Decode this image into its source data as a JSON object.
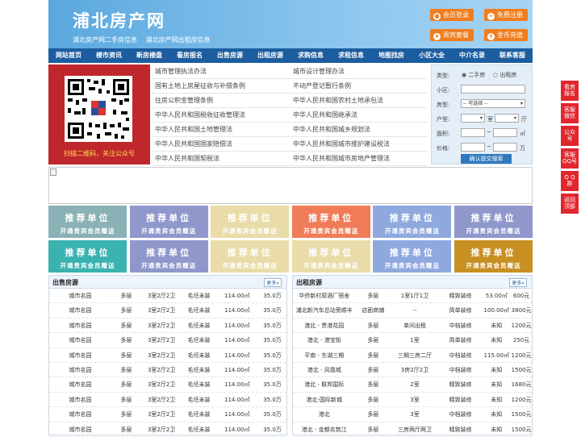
{
  "header": {
    "logo": "浦北房产网",
    "subtitle_1": "浦北房产网二手房信息",
    "subtitle_2": "浦北房产网出租房信息",
    "buttons": [
      "会员登录",
      "免费注册",
      "贵宾套餐",
      "金币充值"
    ]
  },
  "nav": [
    "网站首页",
    "楼市资讯",
    "新房楼盘",
    "看房报名",
    "出售房源",
    "出租房源",
    "求购信息",
    "求租信息",
    "地图找房",
    "小区大全",
    "中介名录",
    "联系客服"
  ],
  "qr": {
    "caption": "扫描二维码，关注公众号"
  },
  "laws": [
    [
      "城市管理执法办法",
      "城市设计管理办法"
    ],
    [
      "国有土地上房屋征收与补偿条例",
      "不动产登记暂行条例"
    ],
    [
      "住房公积金管理条例",
      "中华人民共和国农村土地承包法"
    ],
    [
      "中华人民共和国税收征收管理法",
      "中华人民共和国继承法"
    ],
    [
      "中华人民共和国土地管理法",
      "中华人民共和国城乡规划法"
    ],
    [
      "中华人民共和国国家赔偿法",
      "中华人民共和国城市维护建设税法"
    ],
    [
      "中华人民共和国契税法",
      "中华人民共和国城市房地产管理法"
    ]
  ],
  "search": {
    "type_label": "类型:",
    "type_options": [
      "二手房",
      "出租房"
    ],
    "community_label": "小区:",
    "housetype_label": "房型:",
    "housetype_value": "-- 可选择 --",
    "layout_label": "户型:",
    "room_unit": "室",
    "hall_unit": "厅",
    "area_label": "面积:",
    "area_unit": "㎡",
    "price_label": "价格:",
    "price_unit": "万",
    "submit": "确认提交搜索"
  },
  "ads": {
    "title": "推荐单位",
    "sub": "开通贵宾会员赠送"
  },
  "colors": {
    "ad_row1": [
      "#8ab1b5",
      "#8f97cb",
      "#e9dca9",
      "#ef7c57",
      "#8fa9df",
      "#8f97cb"
    ],
    "ad_row2": [
      "#3ab2b0",
      "#8f97cb",
      "#e9dca9",
      "#e9dca9",
      "#8fa9df",
      "#c88f22"
    ]
  },
  "sale": {
    "title": "出售房源",
    "more": "更多»",
    "rows": [
      [
        "城市名园",
        "多层",
        "3室2厅2卫",
        "毛坯未装",
        "114.00㎡",
        "35.0万"
      ],
      [
        "城市名园",
        "多层",
        "3室2厅2卫",
        "毛坯未装",
        "114.00㎡",
        "35.0万"
      ],
      [
        "城市名园",
        "多层",
        "3室2厅2卫",
        "毛坯未装",
        "114.00㎡",
        "35.0万"
      ],
      [
        "城市名园",
        "多层",
        "3室2厅2卫",
        "毛坯未装",
        "114.00㎡",
        "35.0万"
      ],
      [
        "城市名园",
        "多层",
        "3室2厅2卫",
        "毛坯未装",
        "114.00㎡",
        "35.0万"
      ],
      [
        "城市名园",
        "多层",
        "3室2厅2卫",
        "毛坯未装",
        "114.00㎡",
        "35.0万"
      ],
      [
        "城市名园",
        "多层",
        "3室2厅2卫",
        "毛坯未装",
        "114.00㎡",
        "35.0万"
      ],
      [
        "城市名园",
        "多层",
        "3室2厅2卫",
        "毛坯未装",
        "114.00㎡",
        "35.0万"
      ],
      [
        "城市名园",
        "多层",
        "3室2厅2卫",
        "毛坯未装",
        "114.00㎡",
        "35.0万"
      ],
      [
        "城市名园",
        "多层",
        "3室2厅2卫",
        "毛坯未装",
        "114.00㎡",
        "35.0万"
      ]
    ]
  },
  "rent": {
    "title": "出租房源",
    "more": "更多»",
    "rows": [
      [
        "华侨新村原酒厂宿舍",
        "多层",
        "1室1厅1卫",
        "精致装修",
        "53.00㎡",
        "600元"
      ],
      [
        "浦北新汽车总站旁顺丰",
        "店面商铺",
        "--",
        "简单装修",
        "100.00㎡",
        "3800元"
      ],
      [
        "港北 - 贵港花园",
        "多层",
        "单间出租",
        "中档装修",
        "未知",
        "1200元"
      ],
      [
        "港北 - 港宝街",
        "多层",
        "1室",
        "简单装修",
        "未知",
        "250元"
      ],
      [
        "平南 - 东湖三期",
        "多层",
        "三期三房二厅",
        "中档装修",
        "115.00㎡",
        "1200元"
      ],
      [
        "港北 - 凤凰城",
        "多层",
        "3房2厅2卫",
        "中档装修",
        "未知",
        "1500元"
      ],
      [
        "港北 - 联邦国际",
        "多层",
        "2室",
        "精致装修",
        "未知",
        "1680元"
      ],
      [
        "港北-国际新城",
        "多层",
        "3室",
        "精致装修",
        "未知",
        "1200元"
      ],
      [
        "港北",
        "多层",
        "3室",
        "中档装修",
        "未知",
        "1500元"
      ],
      [
        "港北 - 金都名筑江",
        "多层",
        "三房两厅两卫",
        "精致装修",
        "未知",
        "1500元"
      ]
    ]
  },
  "sidebar": [
    [
      "看房",
      "报名"
    ],
    [
      "客服",
      "微信"
    ],
    [
      "公众",
      "号"
    ],
    [
      "客服",
      "QQ号"
    ],
    [
      "Q Q",
      "群"
    ],
    [
      "返回",
      "顶部"
    ]
  ]
}
